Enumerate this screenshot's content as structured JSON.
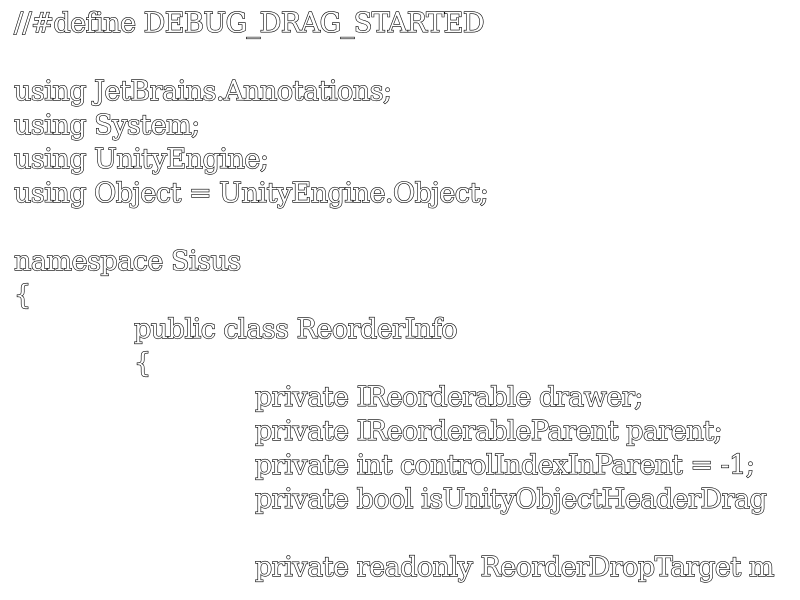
{
  "code": {
    "lines": [
      "//#define DEBUG_DRAG_STARTED",
      "",
      "using JetBrains.Annotations;",
      "using System;",
      "using UnityEngine;",
      "using Object = UnityEngine.Object;",
      "",
      "namespace Sisus",
      "{",
      "public class ReorderInfo",
      "{",
      "private IReorderable drawer;",
      "private IReorderableParent parent;",
      "private int controlIndexInParent = -1;",
      "private bool isUnityObjectHeaderDrag",
      "",
      "private readonly ReorderDropTarget m"
    ]
  }
}
